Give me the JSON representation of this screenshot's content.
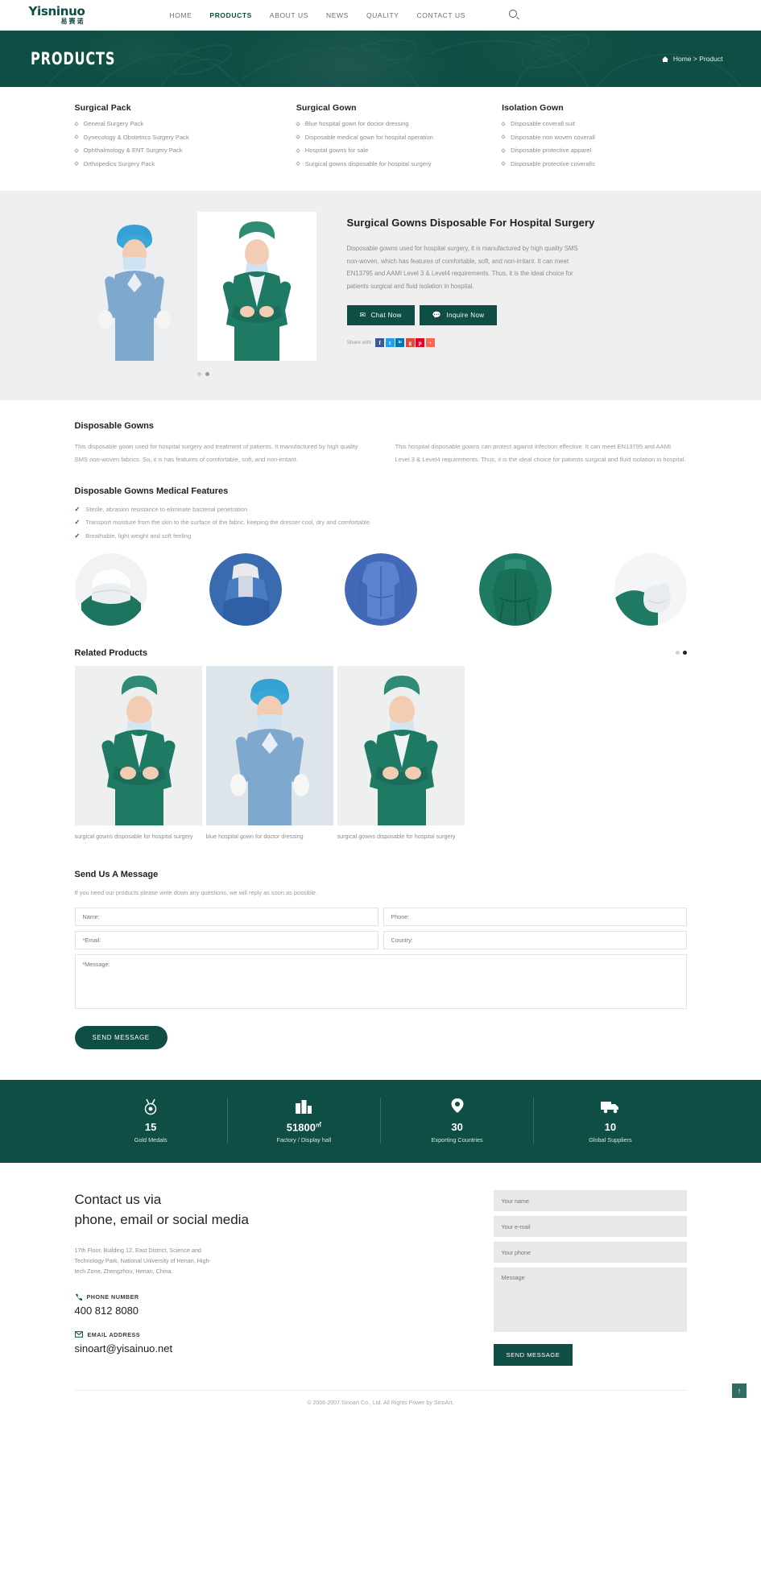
{
  "header": {
    "logo_main": "Yisninuo",
    "logo_sub": "易赛诺",
    "nav": [
      {
        "label": "HOME",
        "active": false
      },
      {
        "label": "PRODUCTS",
        "active": true
      },
      {
        "label": "ABOUT US",
        "active": false
      },
      {
        "label": "NEWS",
        "active": false
      },
      {
        "label": "QUALITY",
        "active": false
      },
      {
        "label": "CONTACT US",
        "active": false
      }
    ],
    "search_icon": "search-icon"
  },
  "hero": {
    "title": "PRODUCTS",
    "breadcrumb": "Home > Product",
    "home_icon": "home-icon",
    "bg_color": "#0f4e44"
  },
  "categories": [
    {
      "title": "Surgical Pack",
      "items": [
        "General Surgery Pack",
        "Gynecology & Obstetrics Surgery Pack",
        "Ophthalmology & ENT Surgery Pack",
        "Orthopedics Surgery Pack"
      ]
    },
    {
      "title": "Surgical Gown",
      "items": [
        "Blue hospital gown for doctor dressing",
        "Disposable medical gown for hospital operation",
        "Hospital gowns for sale",
        "Surgical gowns disposable for hospital surgery"
      ]
    },
    {
      "title": "Isolation Gown",
      "items": [
        "Disposable coverall suit",
        "Disposable non woven coverall",
        "Disposable protective apparel",
        "Disposable protective coveralls"
      ]
    }
  ],
  "product": {
    "title": "Surgical Gowns Disposable For Hospital Surgery",
    "description": "Disposable gowns used for hospital surgery, it is manufactured by high quality SMS non-woven, which has features of comfortable, soft, and non-irritant. It can meet EN13795 and AAMI Level 3 & Level4 requirements. Thus, it is the ideal choice for patients surgical and fluid isolation in hospital.",
    "chat_label": "Chat Now",
    "chat_icon": "envelope-icon",
    "inquire_label": "Inquire Now",
    "inquire_icon": "chat-bubble-icon",
    "share_label": "Share with",
    "share_icons": [
      {
        "name": "facebook-icon",
        "glyph": "f",
        "color": "#3b5998"
      },
      {
        "name": "twitter-icon",
        "glyph": "t",
        "color": "#1da1f2"
      },
      {
        "name": "linkedin-icon",
        "glyph": "in",
        "color": "#0077b5"
      },
      {
        "name": "google-plus-icon",
        "glyph": "g",
        "color": "#dd4b39"
      },
      {
        "name": "pinterest-icon",
        "glyph": "p",
        "color": "#e60023"
      },
      {
        "name": "share-more-icon",
        "glyph": "+",
        "color": "#ff6550"
      }
    ],
    "gallery_dots": [
      false,
      true
    ]
  },
  "gowns": {
    "title": "Disposable Gowns",
    "paragraph_left": "This disposable gown used for hospital surgery and treatment of patients. It manufactured by high quality SMS non-woven fabrics. So, it is has features of comfortable, soft, and non-irritant.",
    "paragraph_right": "This hospital disposable gowns can protect against infection effective. It can meet EN13795 and AAMI Level 3 & Level4 requirements. Thus, it is the ideal choice for patients surgical and fluid isolation in hospital.",
    "features_title": "Disposable Gowns Medical Features",
    "features": [
      "Sterile, abrasion resistance to eliminate bacterial penetration",
      "Transport moisture from the skin to the surface of the fabric, keeping the dresser cool, dry and comfortable.",
      "Breathable, light weight and soft feeling"
    ]
  },
  "related": {
    "title": "Related Products",
    "dots": [
      false,
      true
    ],
    "items": [
      {
        "caption": "surgical gowns disposable for hospital surgery"
      },
      {
        "caption": "blue hospital gown for doctor dressing"
      },
      {
        "caption": "surgical gowns disposable for hospital surgery"
      }
    ]
  },
  "message_form": {
    "title": "Send Us A Message",
    "subtitle": "If you need our products please write down any questions, we will reply as soon as possible.",
    "name_placeholder": "Name:",
    "phone_placeholder": "Phone:",
    "email_placeholder": "*Email:",
    "country_placeholder": "Country:",
    "message_placeholder": "*Message:",
    "submit_label": "SEND MESSAGE"
  },
  "stats": [
    {
      "icon": "medal-icon",
      "number": "15",
      "unit": "",
      "label": "Gold Medals"
    },
    {
      "icon": "factory-icon",
      "number": "51800",
      "unit": "㎡",
      "label": "Factory / Display hall"
    },
    {
      "icon": "location-pin-icon",
      "number": "30",
      "unit": "",
      "label": "Exporting Countries"
    },
    {
      "icon": "truck-icon",
      "number": "10",
      "unit": "",
      "label": "Global Suppliers"
    }
  ],
  "footer": {
    "heading_line1": "Contact us via",
    "heading_line2": "phone, email or social media",
    "address": "17th Floor, Building 12, East District, Science and Technology Park, National University of Henan, High-tech Zone, Zhengzhou, Henan, China.",
    "phone_label": "PHONE NUMBER",
    "phone_icon": "phone-icon",
    "phone_value": "400 812 8080",
    "email_label": "EMAIL ADDRESS",
    "email_icon": "envelope-icon",
    "email_value": "sinoart@yisainuo.net",
    "form": {
      "name_placeholder": "Your name",
      "email_placeholder": "Your e-mail",
      "phone_placeholder": "Your phone",
      "message_placeholder": "Message",
      "submit_label": "SEND MESSAGE"
    },
    "copyright": "© 2006-2007 Sinoart Co., Ltd. All Rights Power by SinoArt.",
    "to_top_icon": "arrow-up-icon"
  }
}
